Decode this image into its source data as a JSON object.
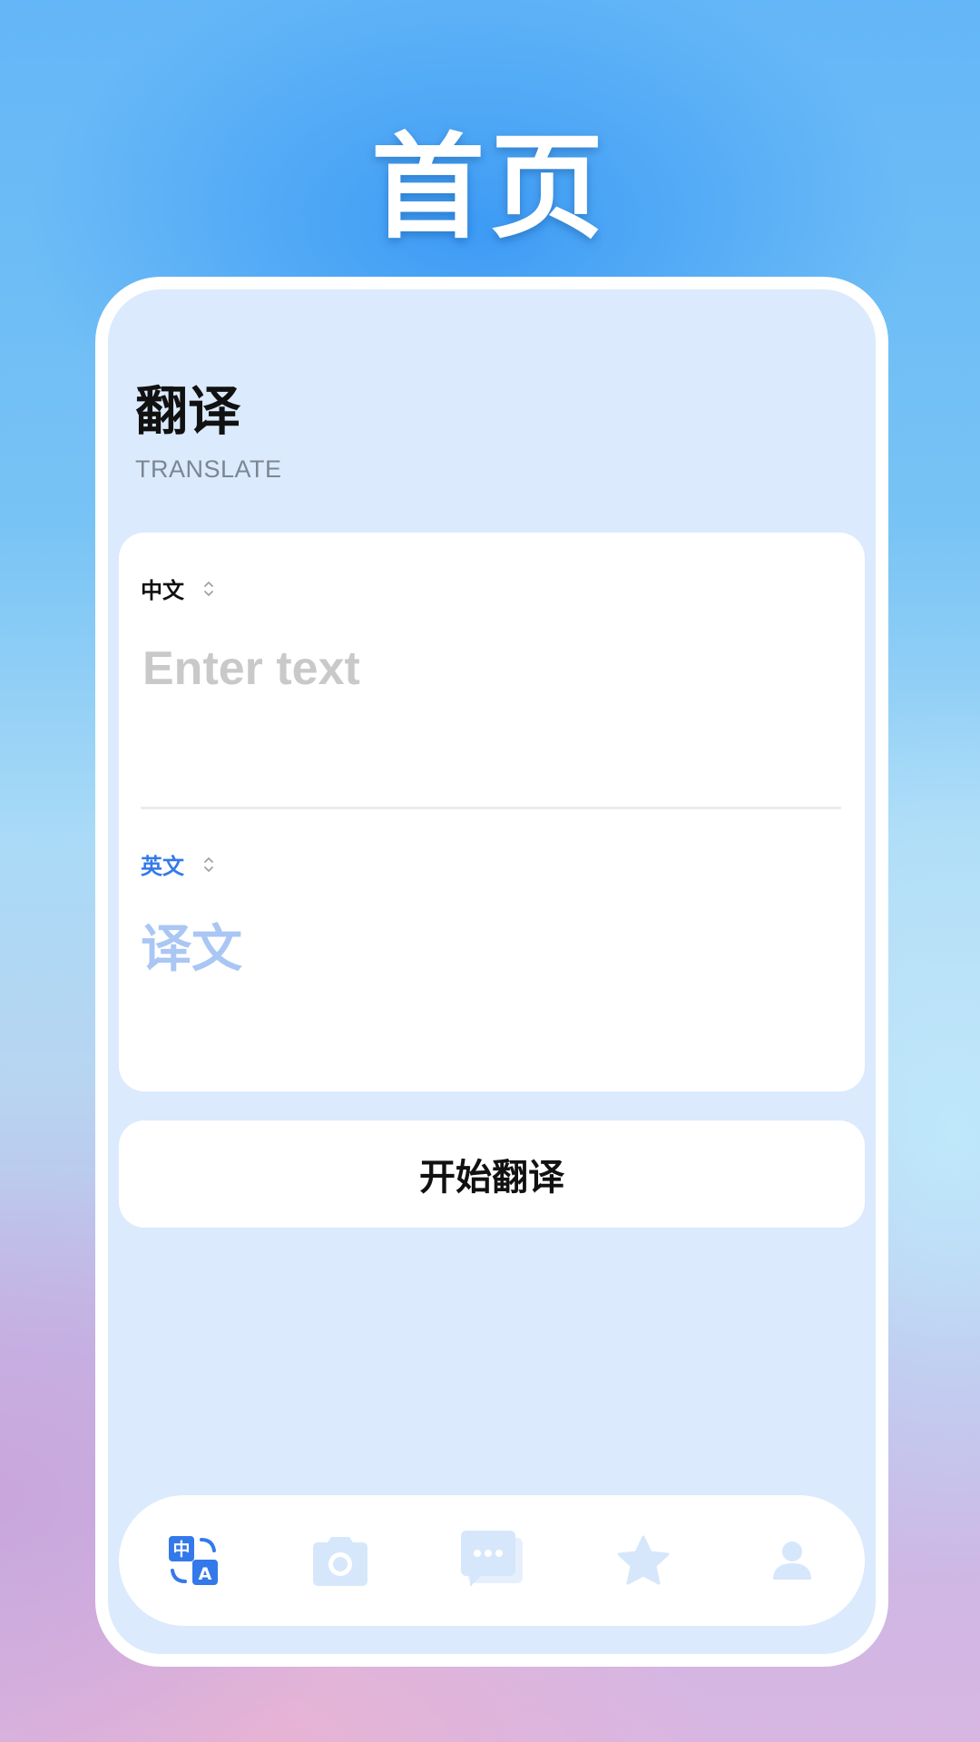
{
  "page_title": "首页",
  "header": {
    "title": "翻译",
    "subtitle": "TRANSLATE"
  },
  "translator": {
    "source_language": "中文",
    "target_language": "英文",
    "input_placeholder": "Enter text",
    "output_placeholder": "译文"
  },
  "translate_button_label": "开始翻译",
  "tabs": [
    {
      "icon": "translate-icon",
      "active": true
    },
    {
      "icon": "camera-icon",
      "active": false
    },
    {
      "icon": "chat-icon",
      "active": false
    },
    {
      "icon": "star-icon",
      "active": false
    },
    {
      "icon": "user-icon",
      "active": false
    }
  ],
  "colors": {
    "accent": "#3479ea",
    "card_background": "#dbeafc",
    "inactive_icon": "#d6e7fb",
    "placeholder": "#c9c9c9",
    "output_placeholder": "#a9c6f4"
  },
  "translate_icon_glyphs": {
    "source": "中",
    "target": "A"
  }
}
